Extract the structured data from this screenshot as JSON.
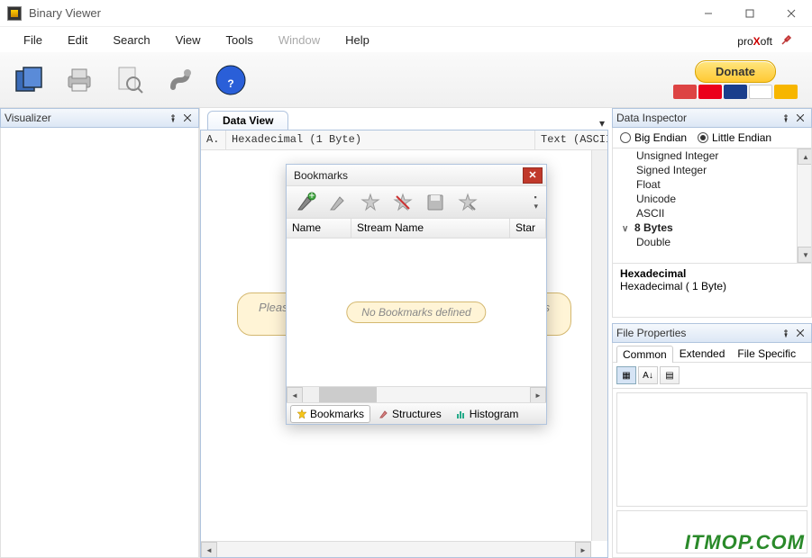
{
  "window": {
    "title": "Binary Viewer"
  },
  "menu": {
    "file": "File",
    "edit": "Edit",
    "search": "Search",
    "view": "View",
    "tools": "Tools",
    "window": "Window",
    "help": "Help"
  },
  "brand": {
    "pre": "pro",
    "x": "X",
    "post": "oft"
  },
  "donate": {
    "label": "Donate"
  },
  "panels": {
    "visualizer": {
      "title": "Visualizer"
    },
    "dataview": {
      "tab": "Data View",
      "col_a": "A.",
      "col_hex": "Hexadecimal (1 Byte)",
      "col_text": "Text (ASCII",
      "placeholder": "Please open any file or drag and drop file from Windows Explorer into this area."
    },
    "inspector": {
      "title": "Data Inspector",
      "big": "Big Endian",
      "little": "Little Endian",
      "items": [
        "Unsigned Integer",
        "Signed Integer",
        "Float",
        "Unicode",
        "ASCII"
      ],
      "group": "8 Bytes",
      "items2": [
        "Double"
      ],
      "hex_hdr": "Hexadecimal",
      "hex_val": "Hexadecimal ( 1 Byte)"
    },
    "fileprops": {
      "title": "File Properties",
      "tabs": {
        "common": "Common",
        "extended": "Extended",
        "specific": "File Specific"
      }
    }
  },
  "bookmarks": {
    "title": "Bookmarks",
    "cols": {
      "name": "Name",
      "stream": "Stream Name",
      "star": "Star"
    },
    "empty": "No Bookmarks defined",
    "tabs": {
      "bookmarks": "Bookmarks",
      "structures": "Structures",
      "histogram": "Histogram"
    }
  },
  "watermark": "ITMOP.COM"
}
